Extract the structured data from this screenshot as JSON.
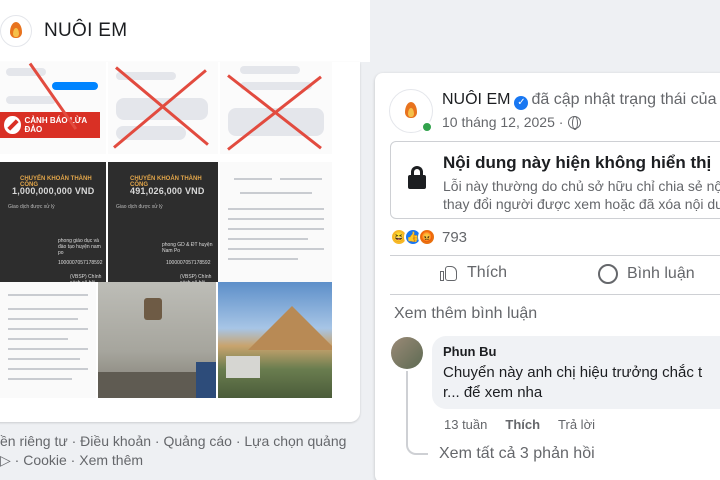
{
  "header": {
    "page_name": "NUÔI EM",
    "logo_icon": "campfire-logo-icon"
  },
  "grid": {
    "warning_label": "CẢNH BÁO LỪA ĐẢO",
    "transfer_title": "CHUYỂN KHOẢN THÀNH CÔNG",
    "transfer_amount_1": "1,000,000,000 VND",
    "transfer_amount_2": "491,026,000 VND",
    "transfer_bank_1": "phong giáo dục và đào tạo huyện nam po",
    "transfer_bank_2": "phong GD & ĐT huyện Nam Po",
    "account_number": "1000007057178592",
    "transfer_note": "(VBSP) Chính sách xã hội"
  },
  "footer": {
    "line1": "ền riêng tư · Điều khoản · Quảng cáo · Lựa chọn quảng",
    "line2": "▷ · Cookie · Xem thêm"
  },
  "post": {
    "author": "NUÔI EM",
    "status": "đã cập nhật trạng thái của",
    "time": "10 tháng 12, 2025 ·",
    "unavailable_title": "Nội dung này hiện không hiển thị",
    "unavailable_desc_1": "Lỗi này thường do chủ sở hữu chỉ chia sẻ nội",
    "unavailable_desc_2": "thay đổi người được xem hoặc đã xóa nội du",
    "reaction_count": "793",
    "like_label": "Thích",
    "comment_label": "Bình luận",
    "more_comments": "Xem thêm bình luận",
    "comment": {
      "name": "Phun Bu",
      "text_1": "Chuyển này anh chị hiệu trưởng chắc t",
      "text_2": "r... để xem nha",
      "age": "13 tuần",
      "like": "Thích",
      "reply": "Trả lời"
    },
    "view_replies": "Xem tất cả 3 phản hồi"
  },
  "colors": {
    "accent": "#1877f2",
    "warning": "#d93025",
    "online": "#31a24c"
  }
}
